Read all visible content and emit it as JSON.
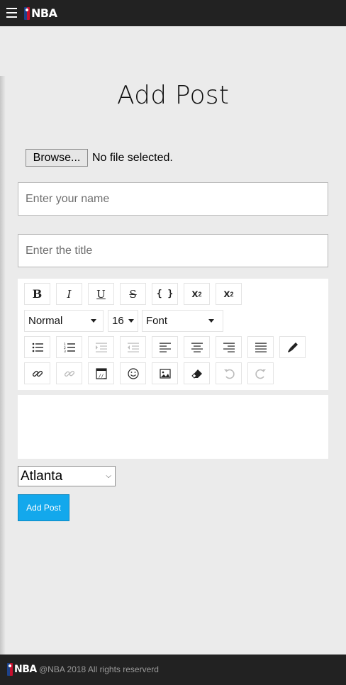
{
  "header": {
    "logo_text": "NBA",
    "menu_icon": "hamburger-icon"
  },
  "page": {
    "title": "Add Post"
  },
  "file_upload": {
    "button_label": "Browse...",
    "status": "No file selected."
  },
  "fields": {
    "name_placeholder": "Enter your name",
    "title_placeholder": "Enter the title"
  },
  "toolbar": {
    "row1": [
      {
        "icon": "bold-icon",
        "glyph": "B"
      },
      {
        "icon": "italic-icon",
        "glyph": "I"
      },
      {
        "icon": "underline-icon",
        "glyph": "U"
      },
      {
        "icon": "strikethrough-icon",
        "glyph": "S"
      },
      {
        "icon": "code-icon",
        "glyph": "{ }"
      },
      {
        "icon": "superscript-icon",
        "glyph": "x²"
      },
      {
        "icon": "subscript-icon",
        "glyph": "x₂"
      }
    ],
    "format_select": "Normal",
    "size_select": "16",
    "font_select": "Font",
    "row3": [
      {
        "icon": "bullet-list-icon"
      },
      {
        "icon": "numbered-list-icon"
      },
      {
        "icon": "indent-icon",
        "disabled": true
      },
      {
        "icon": "outdent-icon",
        "disabled": true
      },
      {
        "icon": "align-left-icon"
      },
      {
        "icon": "align-center-icon"
      },
      {
        "icon": "align-right-icon"
      },
      {
        "icon": "align-justify-icon"
      },
      {
        "icon": "color-picker-icon"
      }
    ],
    "row4": [
      {
        "icon": "link-icon"
      },
      {
        "icon": "unlink-icon",
        "disabled": true
      },
      {
        "icon": "embed-icon"
      },
      {
        "icon": "emoji-icon"
      },
      {
        "icon": "image-icon"
      },
      {
        "icon": "eraser-icon"
      },
      {
        "icon": "undo-icon",
        "disabled": true
      },
      {
        "icon": "redo-icon",
        "disabled": true
      }
    ]
  },
  "city_select": {
    "selected": "Atlanta"
  },
  "submit": {
    "label": "Add Post"
  },
  "footer": {
    "logo_text": "NBA",
    "copyright": "@NBA 2018 All rights reserverd"
  },
  "colors": {
    "topbar": "#222222",
    "background": "#ebebeb",
    "button_blue": "#13a8ec"
  }
}
